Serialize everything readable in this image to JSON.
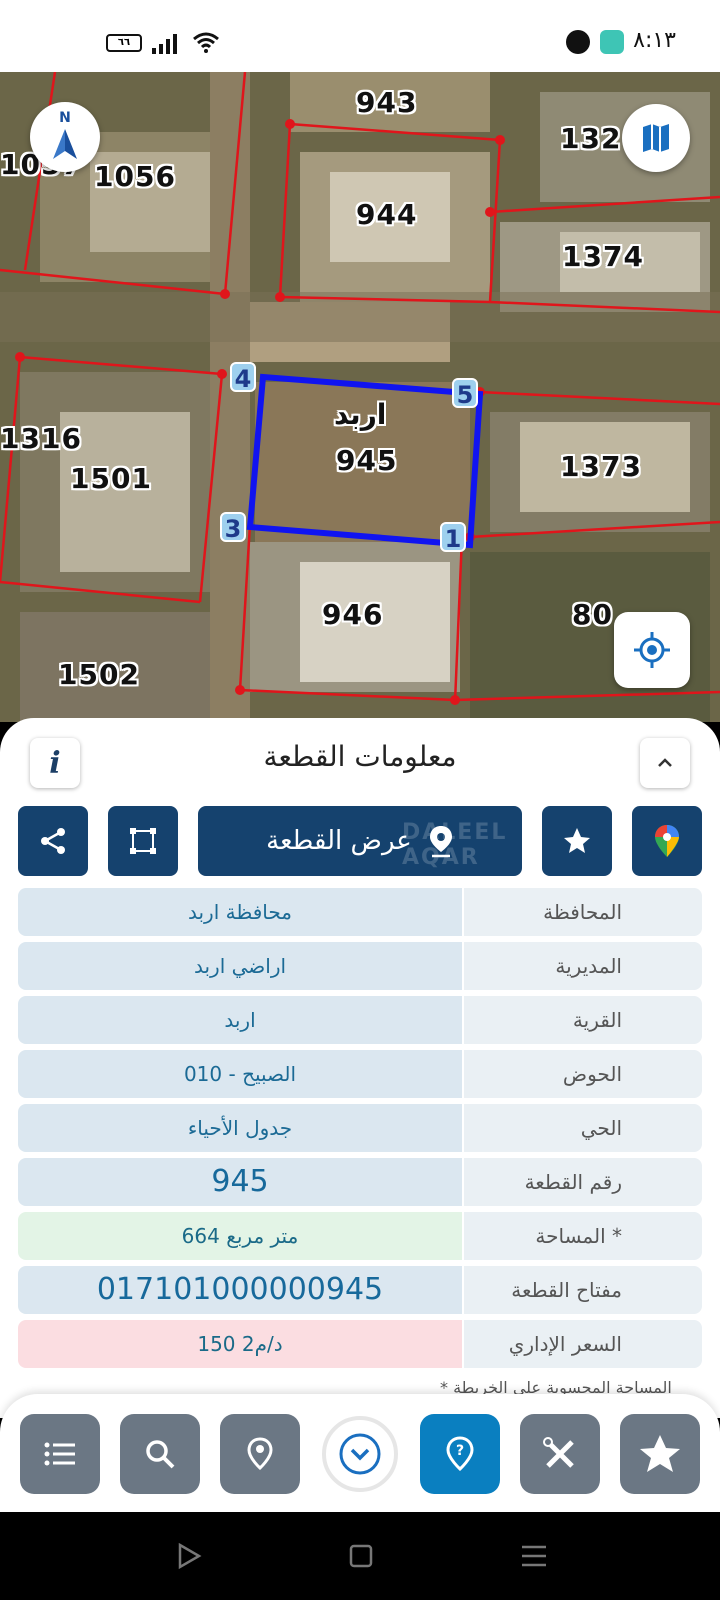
{
  "status_bar": {
    "time": "٨:١٣",
    "battery": "٦٦"
  },
  "map": {
    "plots": [
      {
        "id": "943",
        "label": "943"
      },
      {
        "id": "1056",
        "label": "1056"
      },
      {
        "id": "1057",
        "label": "1057"
      },
      {
        "id": "132",
        "label": "132"
      },
      {
        "id": "944",
        "label": "944"
      },
      {
        "id": "1374",
        "label": "1374"
      },
      {
        "id": "1316",
        "label": "1316"
      },
      {
        "id": "1501",
        "label": "1501"
      },
      {
        "id": "1373",
        "label": "1373"
      },
      {
        "id": "946",
        "label": "946"
      },
      {
        "id": "80",
        "label": "80"
      },
      {
        "id": "1502",
        "label": "1502"
      }
    ],
    "selected": {
      "name": "اربد",
      "number": "945"
    },
    "corners": [
      "1",
      "3",
      "4",
      "5"
    ],
    "north_letter": "N",
    "colors": {
      "boundary": "#e0151b",
      "selected": "#1014f0"
    },
    "icons": [
      "north-arrow-icon",
      "map-layers-icon",
      "my-location-icon"
    ]
  },
  "sheet": {
    "title": "معلومات القطعة",
    "info_icon": "i",
    "show_plot_label": "عرض القطعة",
    "watermark": "DALEEL AQAR",
    "rows": [
      {
        "label": "المحافظة",
        "value": "محافظة اربد"
      },
      {
        "label": "المديرية",
        "value": "اراضي اربد"
      },
      {
        "label": "القرية",
        "value": "اربد"
      },
      {
        "label": "الحوض",
        "value": "الصبيح - 010"
      },
      {
        "label": "الحي",
        "value": "جدول الأحياء"
      },
      {
        "label": "رقم القطعة",
        "value": "945"
      },
      {
        "label": "المساحة *",
        "value": "664  متر مربع"
      },
      {
        "label": "مفتاح القطعة",
        "value": "017101000000945"
      },
      {
        "label": "السعر الإداري",
        "value": "150 د/م2"
      }
    ],
    "footnote": "* المساحة المحسوبة على الخريطة"
  },
  "bottom_nav": {
    "icons": [
      "list-icon",
      "search-icon",
      "location-pin-icon",
      "chevron-down-icon",
      "help-pin-icon",
      "tools-icon",
      "star-icon"
    ],
    "active": "help-pin-icon"
  },
  "accent_colors": {
    "primary": "#15426e",
    "active": "#0a7fc0",
    "nav_gray": "#6b7784"
  }
}
